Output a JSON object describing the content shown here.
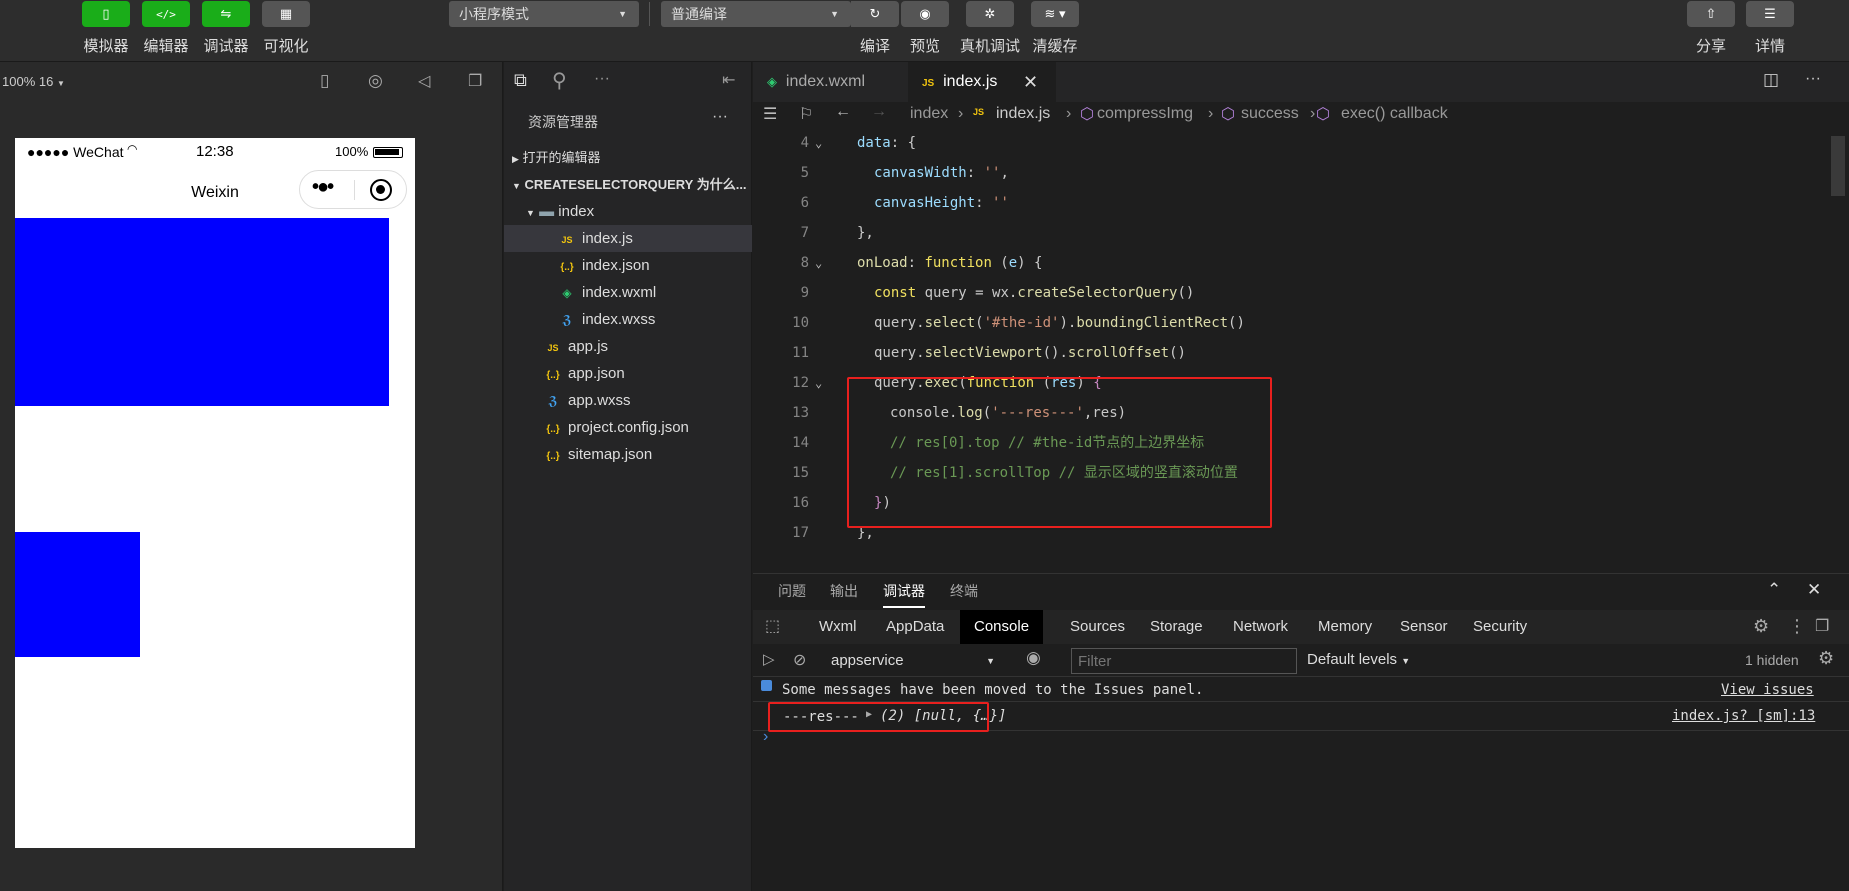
{
  "toolbar": {
    "left_buttons": [
      {
        "label": "模拟器",
        "icon": "phone-icon"
      },
      {
        "label": "编辑器",
        "icon": "code-icon"
      },
      {
        "label": "调试器",
        "icon": "debug-icon"
      },
      {
        "label": "可视化",
        "icon": "layout-icon"
      }
    ],
    "mode_select": "小程序模式",
    "compile_select": "普通编译",
    "mid_buttons": [
      {
        "label": "编译",
        "icon": "refresh-icon"
      },
      {
        "label": "预览",
        "icon": "eye-icon"
      },
      {
        "label": "真机调试",
        "icon": "bug-icon"
      },
      {
        "label": "清缓存",
        "icon": "layers-icon"
      }
    ],
    "right_buttons": [
      {
        "label": "分享",
        "icon": "upload-icon"
      },
      {
        "label": "详情",
        "icon": "menu-icon"
      }
    ]
  },
  "simulator": {
    "zoom": "100% 16",
    "status": {
      "carrier": "●●●●● WeChat",
      "time": "12:38",
      "battery": "100%"
    },
    "nav_title": "Weixin",
    "block_color": "#0000ff"
  },
  "explorer": {
    "title": "资源管理器",
    "open_editors": "打开的编辑器",
    "project": "CREATESELECTORQUERY 为什么...",
    "folder": "index",
    "files": [
      {
        "name": "index.js",
        "icon": "JS"
      },
      {
        "name": "index.json",
        "icon": "{..}"
      },
      {
        "name": "index.wxml",
        "icon": "wxml"
      },
      {
        "name": "index.wxss",
        "icon": "wxss"
      }
    ],
    "root_files": [
      {
        "name": "app.js",
        "icon": "JS"
      },
      {
        "name": "app.json",
        "icon": "{..}"
      },
      {
        "name": "app.wxss",
        "icon": "wxss"
      },
      {
        "name": "project.config.json",
        "icon": "{..}"
      },
      {
        "name": "sitemap.json",
        "icon": "{..}"
      }
    ]
  },
  "editor": {
    "tabs": [
      "index.wxml",
      "index.js"
    ],
    "breadcrumb": [
      "index",
      "index.js",
      "compressImg",
      "success",
      "exec() callback"
    ],
    "lines": [
      {
        "n": "4",
        "text": "data: {"
      },
      {
        "n": "5",
        "text": "canvasWidth: '',"
      },
      {
        "n": "6",
        "text": "canvasHeight: ''"
      },
      {
        "n": "7",
        "text": "},"
      },
      {
        "n": "8",
        "text": "onLoad: function (e) {"
      },
      {
        "n": "9",
        "text": "const query = wx.createSelectorQuery()"
      },
      {
        "n": "10",
        "text": "query.select('#the-id').boundingClientRect()"
      },
      {
        "n": "11",
        "text": "query.selectViewport().scrollOffset()"
      },
      {
        "n": "12",
        "text": "query.exec(function (res) {"
      },
      {
        "n": "13",
        "text": "console.log('---res---',res)"
      },
      {
        "n": "14",
        "text": "// res[0].top // #the-id节点的上边界坐标"
      },
      {
        "n": "15",
        "text": "// res[1].scrollTop // 显示区域的竖直滚动位置"
      },
      {
        "n": "16",
        "text": "})"
      },
      {
        "n": "17",
        "text": "},"
      }
    ]
  },
  "panel": {
    "tabs": [
      "问题",
      "输出",
      "调试器",
      "终端"
    ],
    "devtools_tabs": [
      "Wxml",
      "AppData",
      "Console",
      "Sources",
      "Storage",
      "Network",
      "Memory",
      "Sensor",
      "Security"
    ],
    "context": "appservice",
    "filter_placeholder": "Filter",
    "levels": "Default levels",
    "hidden": "1 hidden",
    "notice": "Some messages have been moved to the Issues panel.",
    "view_issues": "View issues",
    "log_label": "---res---",
    "log_value": "(2) [null, {…}]",
    "log_source": "index.js? [sm]:13",
    "prompt": "›"
  }
}
